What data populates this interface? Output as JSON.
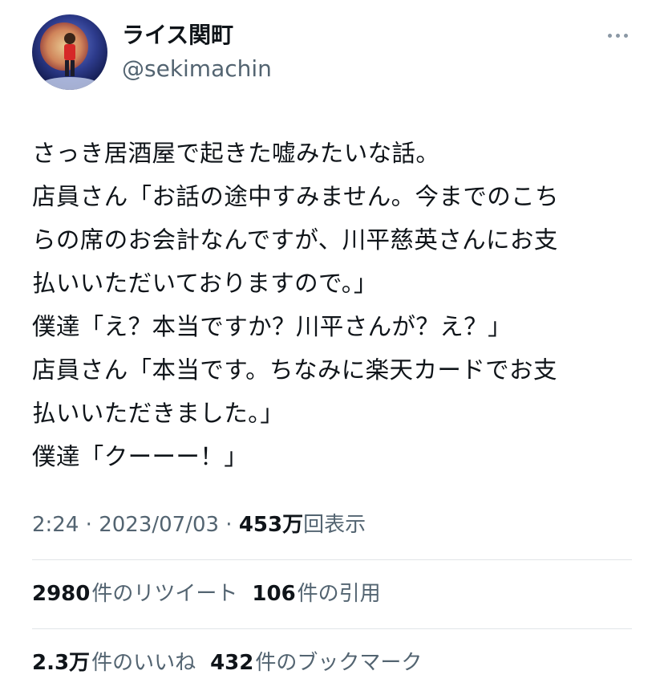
{
  "author": {
    "display_name": "ライス関町",
    "handle": "@sekimachin"
  },
  "tweet": {
    "lines": [
      "さっき居酒屋で起きた嘘みたいな話。",
      "店員さん「お話の途中すみません。今までのこち",
      "らの席のお会計なんですが、川平慈英さんにお支",
      "払いいただいておりますので。」",
      "僕達「え？本当ですか？川平さんが？え？」",
      "店員さん「本当です。ちなみに楽天カードでお支",
      "払いいただきました。」",
      "僕達「クーーー！」"
    ]
  },
  "meta": {
    "time": "2:24",
    "separator": " · ",
    "date": "2023/07/03",
    "views_value": "453万",
    "views_label": "回表示"
  },
  "stats": {
    "retweets_value": "2980",
    "retweets_label": "件のリツイート",
    "quotes_value": "106",
    "quotes_label": "件の引用",
    "likes_value": "2.3万",
    "likes_label": "件のいいね",
    "bookmarks_value": "432",
    "bookmarks_label": "件のブックマーク"
  },
  "icons": {
    "more": "more-horizontal-icon",
    "avatar": "avatar-image"
  },
  "colors": {
    "text_primary": "#0f1419",
    "text_secondary": "#536471",
    "divider": "#e1e5e8"
  }
}
